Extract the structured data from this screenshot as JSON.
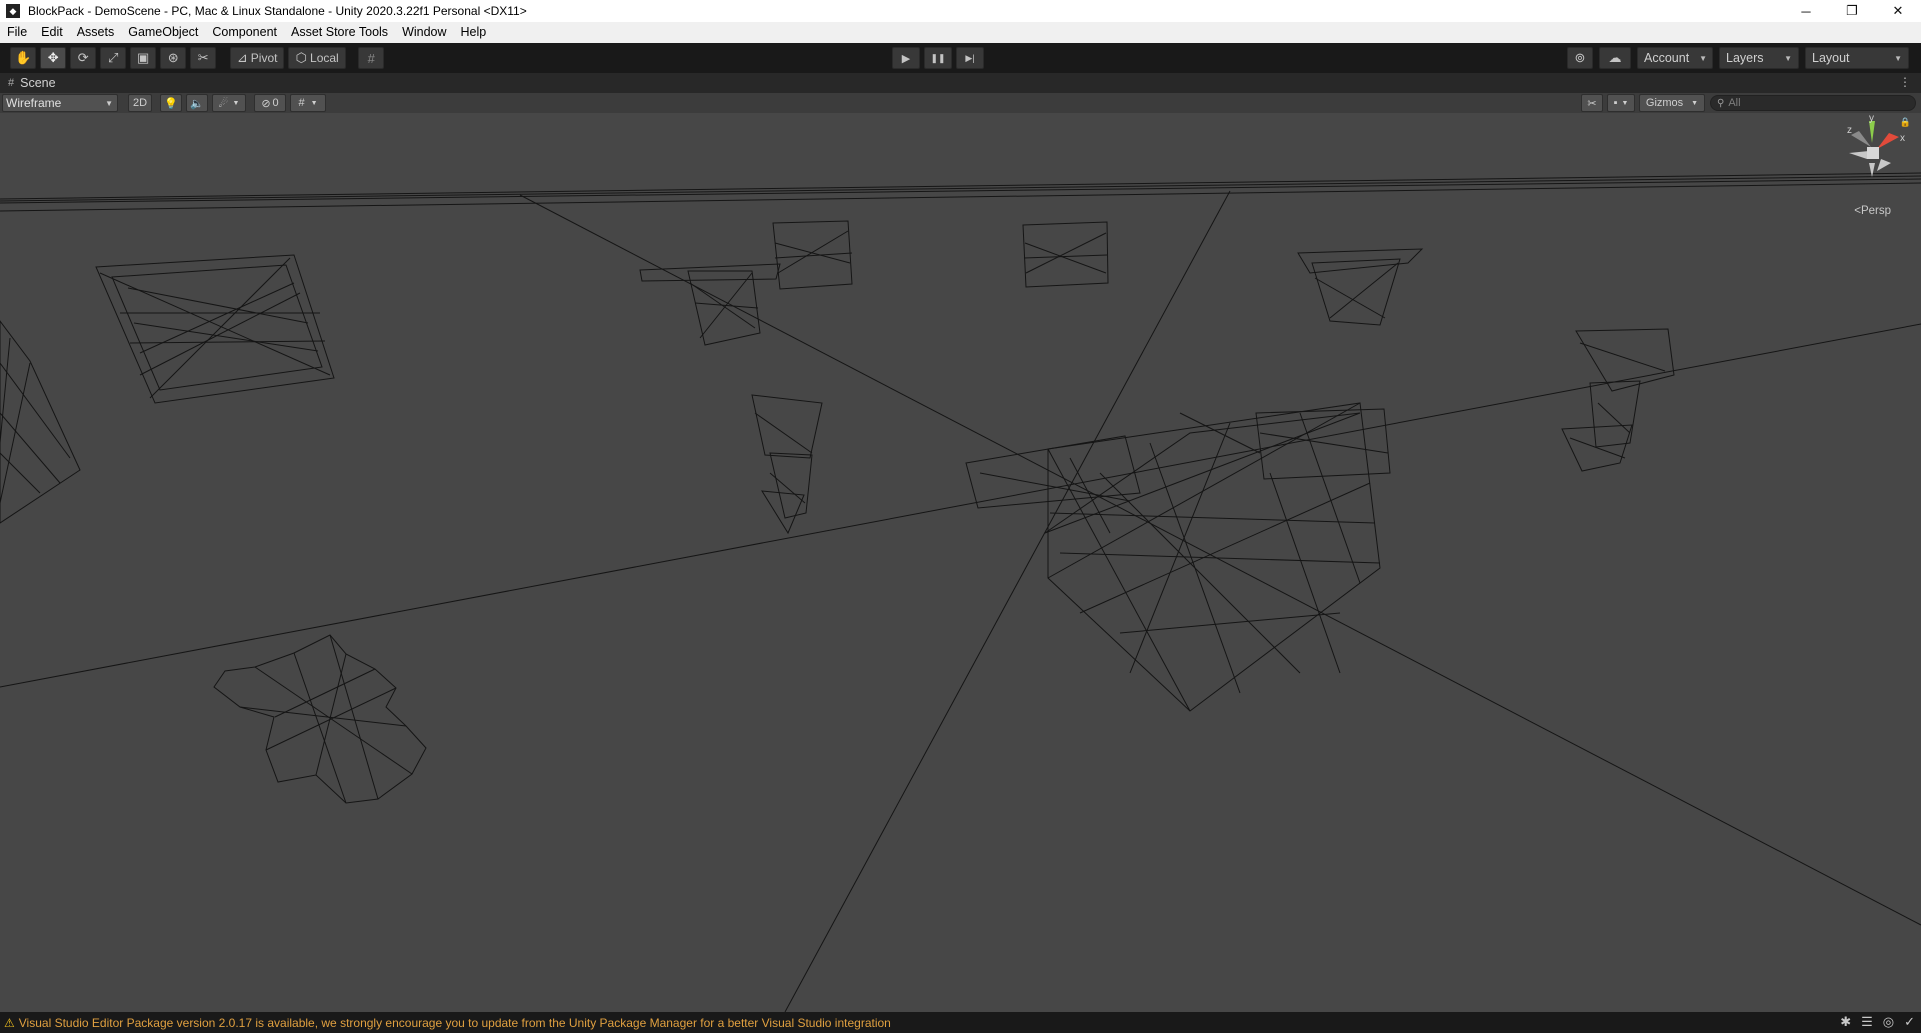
{
  "window": {
    "title": "BlockPack - DemoScene - PC, Mac & Linux Standalone - Unity 2020.3.22f1 Personal <DX11>",
    "app_icon": "unity-logo-icon",
    "controls": {
      "minimize": "─",
      "maximize": "❐",
      "close": "✕"
    }
  },
  "menu": [
    "File",
    "Edit",
    "Assets",
    "GameObject",
    "Component",
    "Asset Store Tools",
    "Window",
    "Help"
  ],
  "toolbar": {
    "tools": [
      {
        "name": "hand-tool",
        "glyph": "✋"
      },
      {
        "name": "move-tool",
        "glyph": "✥"
      },
      {
        "name": "rotate-tool",
        "glyph": "⟳"
      },
      {
        "name": "scale-tool",
        "glyph": "⤢"
      },
      {
        "name": "rect-tool",
        "glyph": "▣"
      },
      {
        "name": "transform-tool",
        "glyph": "⊛"
      },
      {
        "name": "custom-tool",
        "glyph": "✂"
      }
    ],
    "pivot_label": "Pivot",
    "local_label": "Local",
    "play_glyph": "▶",
    "pause_glyph": "❚❚",
    "step_glyph": "▶|",
    "account_label": "Account",
    "layers_label": "Layers",
    "layout_label": "Layout"
  },
  "scene_tab": {
    "label": "Scene",
    "more": "⋮"
  },
  "scene_toolbar": {
    "draw_mode": "Wireframe",
    "mode_2d": "2D",
    "hidden_count": "0",
    "gizmos_label": "Gizmos",
    "search_placeholder": "All"
  },
  "viewport": {
    "projection_label": "<Persp",
    "gizmo_axes": {
      "y": "y",
      "x": "x",
      "z": "z"
    }
  },
  "status": {
    "warning_icon": "warning-icon",
    "message": "Visual Studio Editor Package version 2.0.17 is available, we strongly encourage you to update from the Unity Package Manager for a better Visual Studio integration"
  }
}
